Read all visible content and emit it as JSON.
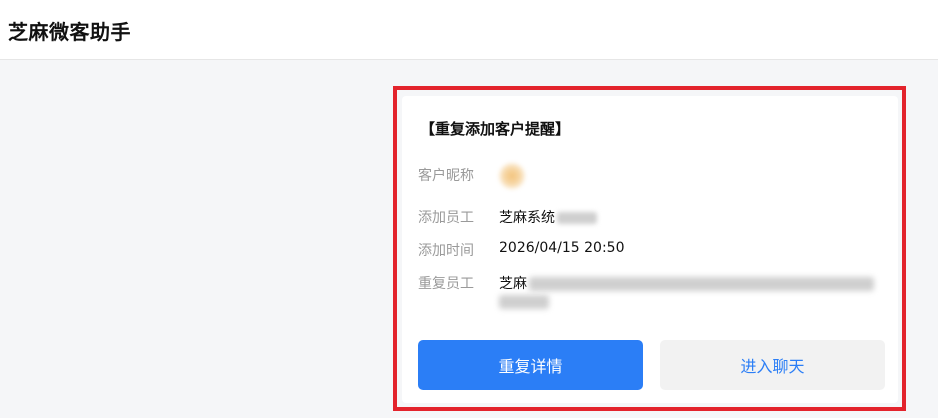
{
  "app": {
    "title": "芝麻微客助手"
  },
  "card": {
    "title": "【重复添加客户提醒】",
    "fields": {
      "nickname_label": "客户昵称",
      "staff_label": "添加员工",
      "staff_value_prefix": "芝麻系统",
      "time_label": "添加时间",
      "time_value": "2026/04/15 20:50",
      "dup_label": "重复员工",
      "dup_value_prefix": "芝麻"
    },
    "buttons": {
      "details": "重复详情",
      "chat": "进入聊天"
    }
  },
  "colors": {
    "accent": "#2b7ef6",
    "highlight_border": "#e3232c",
    "label_gray": "#9a9a9a"
  }
}
